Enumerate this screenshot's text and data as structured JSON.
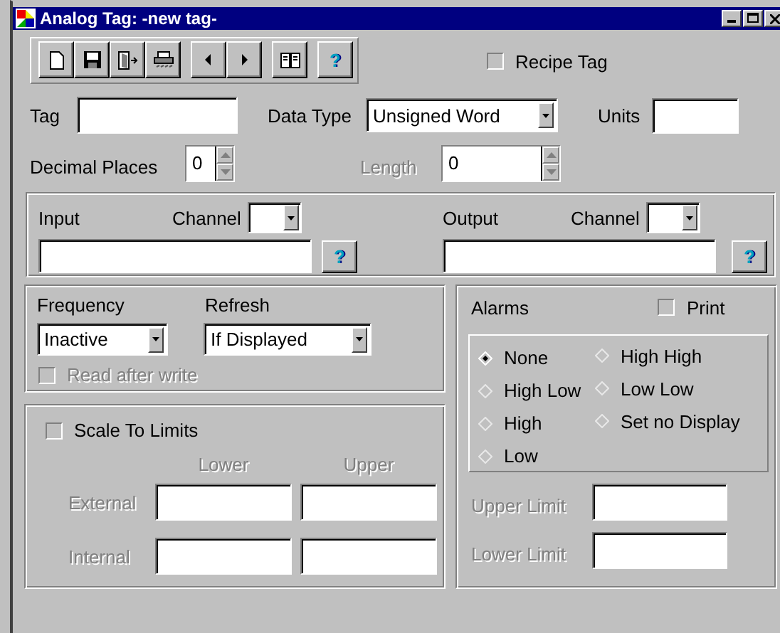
{
  "window": {
    "title": "Analog Tag: -new tag-"
  },
  "toolbar": [
    {
      "buttons": [
        {
          "kind": "page"
        },
        {
          "kind": "disk"
        },
        {
          "kind": "door"
        },
        {
          "kind": "printer"
        }
      ]
    },
    {
      "buttons": [
        {
          "kind": "left"
        },
        {
          "kind": "right"
        }
      ]
    },
    {
      "buttons": [
        {
          "kind": "book"
        }
      ]
    },
    {
      "buttons": [
        {
          "kind": "glyph",
          "glyph": "?"
        }
      ]
    }
  ],
  "recipe_tag": {
    "label": "Recipe Tag",
    "checked": false
  },
  "tag": {
    "label": "Tag"
  },
  "data_type": {
    "label": "Data Type",
    "value": "Unsigned Word"
  },
  "units": {
    "label": "Units"
  },
  "decimal_places": {
    "label": "Decimal Places",
    "value": "0",
    "disabled": false
  },
  "length": {
    "label": "Length",
    "value": "0",
    "disabled": true
  },
  "io": [
    {
      "label": "Input",
      "channel_label": "Channel",
      "help": "?"
    },
    {
      "label": "Output",
      "channel_label": "Channel",
      "help": "?"
    }
  ],
  "frequency": {
    "label": "Frequency",
    "value": "Inactive"
  },
  "refresh": {
    "label": "Refresh",
    "value": "If Displayed"
  },
  "read_after_write": {
    "label": "Read after write",
    "checked": false,
    "disabled": true
  },
  "scale": {
    "label": "Scale To Limits",
    "checked": false,
    "disabled": true,
    "columns": [
      "Lower",
      "Upper"
    ],
    "rows": [
      {
        "label": "External"
      },
      {
        "label": "Internal"
      }
    ]
  },
  "alarms": {
    "label": "Alarms",
    "print": {
      "label": "Print",
      "checked": false
    },
    "options": [
      {
        "label": "None",
        "selected": true
      },
      {
        "label": "High Low",
        "selected": false
      },
      {
        "label": "High",
        "selected": false
      },
      {
        "label": "Low",
        "selected": false
      },
      {
        "label": "High High",
        "selected": false
      },
      {
        "label": "Low Low",
        "selected": false
      },
      {
        "label": "Set no Display",
        "selected": false
      }
    ],
    "limits": [
      {
        "label": "Upper Limit",
        "disabled": true
      },
      {
        "label": "Lower Limit",
        "disabled": true
      }
    ]
  }
}
